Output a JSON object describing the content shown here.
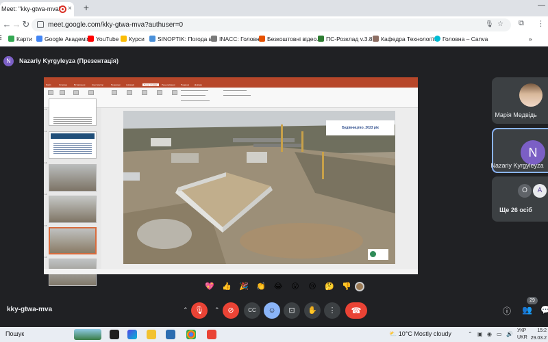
{
  "browser": {
    "tab_title": "Meet: \"kky-gtwa-mva\"",
    "tab_close": "×",
    "new_tab": "+",
    "minimize": "—",
    "url": "meet.google.com/kky-gtwa-mva?authuser=0",
    "back": "←",
    "forward": "→",
    "reload": "↻"
  },
  "bookmarks": [
    {
      "label": "Карти",
      "color": "#34a853"
    },
    {
      "label": "Google Академія",
      "color": "#4285f4"
    },
    {
      "label": "YouTube",
      "color": "#ff0000"
    },
    {
      "label": "Курси",
      "color": "#fbbc04"
    },
    {
      "label": "SINOPTIK: Погода в...",
      "color": "#4a90d9"
    },
    {
      "label": "INACC: Головна",
      "color": "#7a7a7a"
    },
    {
      "label": "Безкоштовні відео...",
      "color": "#e65100"
    },
    {
      "label": "ПС-Розклад v.3.8.2",
      "color": "#2e7d32"
    },
    {
      "label": "Кафедра Технології...",
      "color": "#8d6e63"
    },
    {
      "label": "Головна – Canva",
      "color": "#00bcd4"
    }
  ],
  "meet": {
    "presenter_initial": "N",
    "presenter_label": "Nazariy Kyrgyleyza (Презентація)",
    "meeting_code": "kky-gtwa-mva",
    "people_count": "29"
  },
  "presentation": {
    "slide_label": "Будівництво, 2023 рік",
    "ribbon_tabs": [
      "Файл",
      "Основне",
      "Вставлення",
      "Конструктор",
      "Переходи",
      "Анімація",
      "Показ слайдів",
      "Рецензування",
      "Подання",
      "Довідка"
    ],
    "active_tab": "Показ слайдів",
    "slide_numbers": [
      "11",
      "12",
      "13",
      "14",
      "15",
      "16"
    ]
  },
  "participants": [
    {
      "name": "Марія Медвідь",
      "initial": ""
    },
    {
      "name": "Nazariy Kyrgyleyza",
      "initial": "N"
    },
    {
      "name": "Ще 26 осіб",
      "initials": [
        "O",
        "A"
      ]
    }
  ],
  "reactions": [
    "💖",
    "👍",
    "🎉",
    "👏",
    "😂",
    "😮",
    "😢",
    "🤔",
    "👎"
  ],
  "taskbar": {
    "search": "Пошук",
    "weather": "10°C  Mostly cloudy",
    "lang1": "УКР",
    "lang2": "UKR",
    "time": "15:2",
    "date": "29.03.2"
  }
}
